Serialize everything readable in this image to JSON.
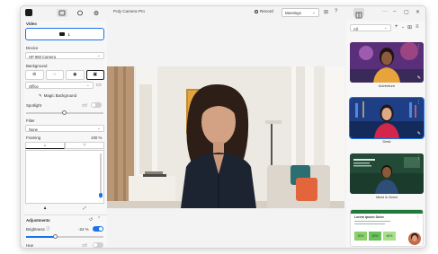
{
  "titlebar": {
    "app_title": "Poly Camera Pro",
    "record_label": "Record",
    "mode_select": "Meetings"
  },
  "left": {
    "video_heading": "Video",
    "video_button": "1",
    "device_label": "Device",
    "device_value": "HP 960 Camera",
    "background_label": "Background",
    "background_value": "Office",
    "magic_background": "Magic Background",
    "spotlight_label": "Spotlight",
    "spotlight_state": "Off",
    "filter_label": "Filter",
    "filter_value": "None",
    "framing_label": "Framing",
    "framing_value": "100 %",
    "adjustments_label": "Adjustments",
    "brightness_label": "Brightness",
    "brightness_value": "-24 %",
    "hue_label": "Hue",
    "hue_state": "Off",
    "brightness_level": 0.38,
    "hue_on": false,
    "brightness_on": true,
    "spotlight_on": false
  },
  "right": {
    "search_value": "All",
    "thumbnails": [
      {
        "label": "Adventure",
        "selected": false
      },
      {
        "label": "Desk",
        "selected": true
      },
      {
        "label": "Meet & Greet",
        "selected": false
      },
      {
        "label": "",
        "selected": false
      }
    ],
    "slide_title": "Lorem Ipsum Dolor",
    "slide_stats": [
      "20%",
      "40%",
      "60%"
    ]
  },
  "colors": {
    "accent": "#1a73e8",
    "panel_bg": "#f7f7f7"
  }
}
